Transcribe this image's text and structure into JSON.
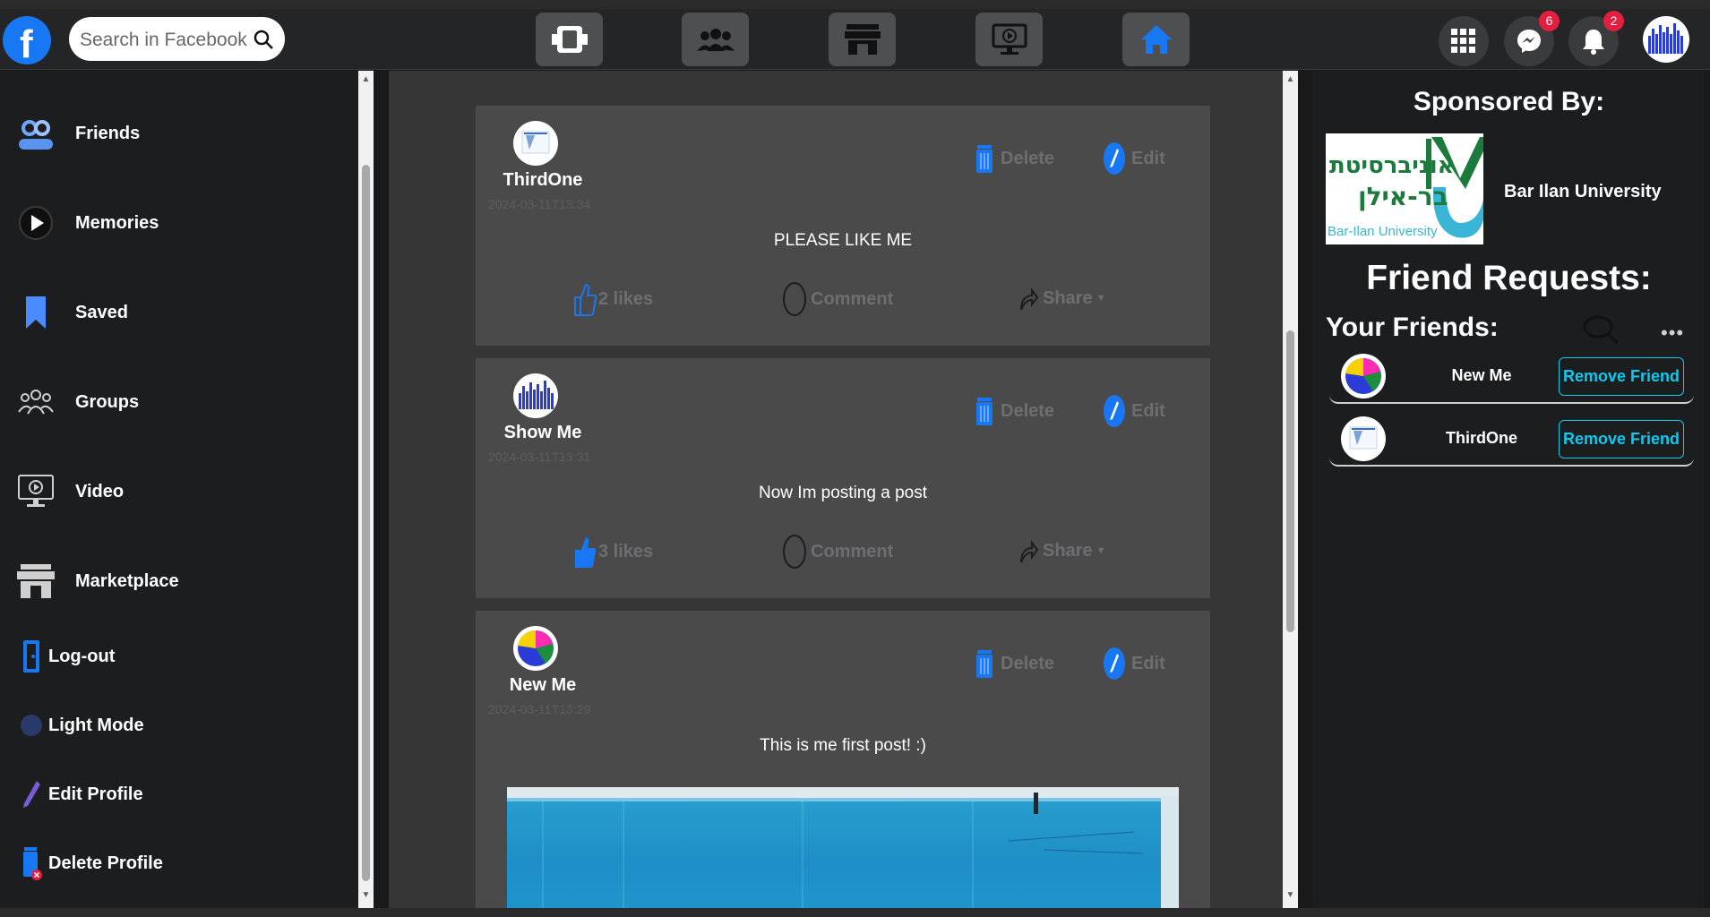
{
  "search": {
    "placeholder": "Search in Facebook"
  },
  "notifications": {
    "messenger_count": "6",
    "bell_count": "2"
  },
  "sidebar": {
    "items": [
      {
        "label": "Friends"
      },
      {
        "label": "Memories"
      },
      {
        "label": "Saved"
      },
      {
        "label": "Groups"
      },
      {
        "label": "Video"
      },
      {
        "label": "Marketplace"
      }
    ],
    "actions": [
      {
        "label": "Log-out"
      },
      {
        "label": "Light Mode"
      },
      {
        "label": "Edit Profile"
      },
      {
        "label": "Delete Profile"
      }
    ]
  },
  "posts": [
    {
      "author": "ThirdOne",
      "date": "2024-03-11T13:34",
      "text": "PLEASE LIKE ME",
      "likes": "2 likes",
      "delete": "Delete",
      "edit": "Edit",
      "comment": "Comment",
      "share": "Share"
    },
    {
      "author": "Show Me",
      "date": "2024-03-11T13:31",
      "text": "Now Im posting a post",
      "likes": "3 likes",
      "delete": "Delete",
      "edit": "Edit",
      "comment": "Comment",
      "share": "Share"
    },
    {
      "author": "New Me",
      "date": "2024-03-11T13:29",
      "text": "This is me first post! :)",
      "delete": "Delete",
      "edit": "Edit"
    }
  ],
  "right": {
    "sponsored_title": "Sponsored By:",
    "sponsor_name": "Bar Ilan University",
    "sponsor_logo_text": [
      "אוניברסיטת",
      "בר-אילן",
      "Bar-Ilan University"
    ],
    "friend_requests_title": "Friend Requests:",
    "your_friends_title": "Your Friends:",
    "friends": [
      {
        "name": "New Me",
        "button": "Remove Friend"
      },
      {
        "name": "ThirdOne",
        "button": "Remove Friend"
      }
    ]
  },
  "colors": {
    "accent": "#1877f2",
    "danger": "#e41e3f",
    "friend_button": "#0dcaf0",
    "post_bg": "#4b4a4b",
    "feed_bg": "#363637"
  }
}
